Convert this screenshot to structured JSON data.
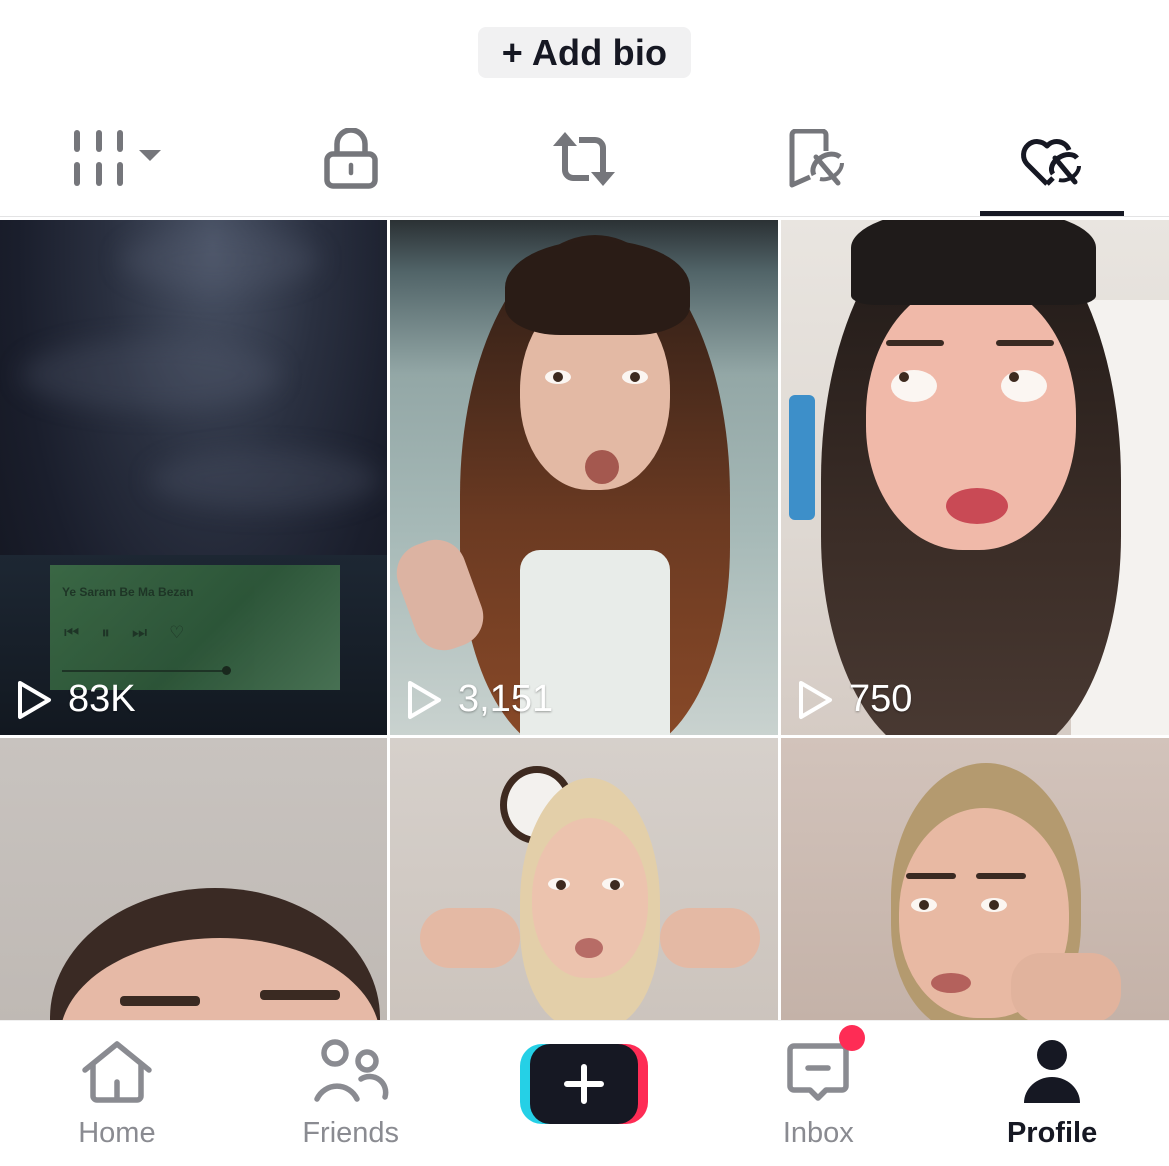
{
  "profile": {
    "add_bio_label": "+ Add bio"
  },
  "content_tabs": [
    {
      "name": "videos",
      "icon": "grid-columns-icon",
      "has_dropdown": true,
      "active": false
    },
    {
      "name": "private",
      "icon": "lock-icon",
      "active": false
    },
    {
      "name": "reposts",
      "icon": "repost-icon",
      "active": false
    },
    {
      "name": "favorites",
      "icon": "bookmark-hidden-icon",
      "active": false
    },
    {
      "name": "liked",
      "icon": "heart-hidden-icon",
      "active": true
    }
  ],
  "videos": [
    {
      "views": "83K",
      "overlay_song": "Ye Saram Be Ma Bezan"
    },
    {
      "views": "3,151"
    },
    {
      "views": "750"
    },
    {
      "views": null
    },
    {
      "views": null
    },
    {
      "views": null
    }
  ],
  "bottom_nav": {
    "items": [
      {
        "label": "Home",
        "icon": "home-icon",
        "active": false
      },
      {
        "label": "Friends",
        "icon": "friends-icon",
        "active": false
      },
      {
        "label": "",
        "icon": "create-plus-icon",
        "active": false
      },
      {
        "label": "Inbox",
        "icon": "inbox-icon",
        "active": false,
        "has_notification": true
      },
      {
        "label": "Profile",
        "icon": "profile-icon",
        "active": true
      }
    ]
  },
  "colors": {
    "primary_text": "#161823",
    "inactive_icon": "#75767b",
    "accent_pink": "#fe2c55",
    "accent_cyan": "#25d0e6",
    "bio_button_bg": "#f1f1f2"
  }
}
